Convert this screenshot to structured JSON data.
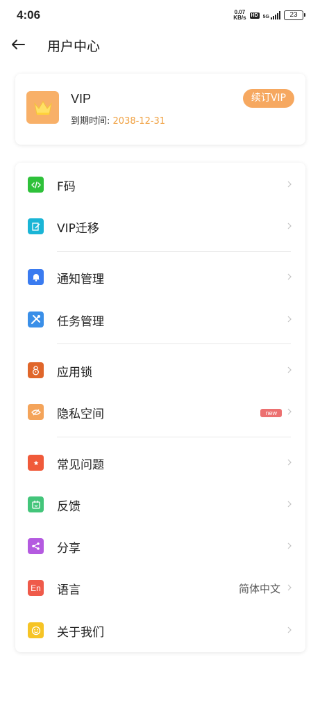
{
  "status_bar": {
    "time": "4:06",
    "net_speed_value": "0.07",
    "net_speed_unit": "KB/s",
    "hd": "HD",
    "signal_label": "5G",
    "battery": "23"
  },
  "header": {
    "title": "用户中心"
  },
  "vip_card": {
    "name": "VIP",
    "expiry_label": "到期时间:",
    "expiry_date": "2038-12-31",
    "renew_label": "续订VIP"
  },
  "menu": {
    "items": [
      {
        "label": "F码",
        "icon": "f-code-icon",
        "color": "#2ec13a"
      },
      {
        "label": "VIP迁移",
        "icon": "vip-migrate-icon",
        "color": "#1ab5d6"
      },
      {
        "label": "通知管理",
        "icon": "bell-icon",
        "color": "#3a7bf0"
      },
      {
        "label": "任务管理",
        "icon": "tools-icon",
        "color": "#3a8fe8"
      },
      {
        "label": "应用锁",
        "icon": "lock-icon",
        "color": "#e0662a"
      },
      {
        "label": "隐私空间",
        "icon": "eye-off-icon",
        "color": "#f4a45a",
        "badge": "new"
      },
      {
        "label": "常见问题",
        "icon": "star-icon",
        "color": "#f05a3a"
      },
      {
        "label": "反馈",
        "icon": "feedback-icon",
        "color": "#43c57a"
      },
      {
        "label": "分享",
        "icon": "share-icon",
        "color": "#b45ae0"
      },
      {
        "label": "语言",
        "icon": "language-icon",
        "color": "#ef5a4a",
        "icon_text": "En",
        "value": "简体中文"
      },
      {
        "label": "关于我们",
        "icon": "smile-icon",
        "color": "#f6c425"
      }
    ]
  }
}
